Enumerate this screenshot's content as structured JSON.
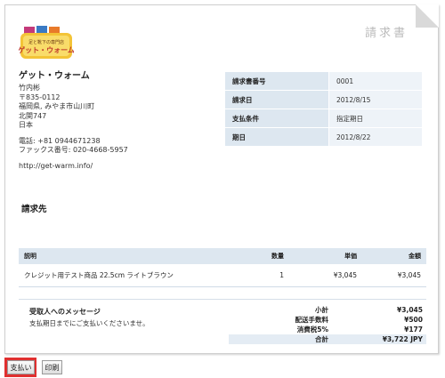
{
  "document": {
    "title": "請求書"
  },
  "logo": {
    "line1": "足と靴下の専門店",
    "line2": "ゲット・ウォーム"
  },
  "seller": {
    "name": "ゲット・ウォーム",
    "contact": "竹内彬",
    "postal": "〒835-0112",
    "address1": "福岡県, みやま市山川町",
    "address2": "北関747",
    "country": "日本",
    "phone": "電話: +81 0944671238",
    "fax": "ファックス番号: 020-4668-5957",
    "url": "http://get-warm.info/"
  },
  "meta": [
    {
      "label": "請求書番号",
      "value": "0001"
    },
    {
      "label": "請求日",
      "value": "2012/8/15"
    },
    {
      "label": "支払条件",
      "value": "指定期日"
    },
    {
      "label": "期日",
      "value": "2012/8/22"
    }
  ],
  "bill_to": {
    "title": "請求先"
  },
  "items": {
    "headers": {
      "desc": "説明",
      "qty": "数量",
      "unit": "単価",
      "amount": "金額"
    },
    "rows": [
      {
        "desc": "クレジット用テスト商品 22.5cm ライトブラウン",
        "qty": "1",
        "unit": "¥3,045",
        "amount": "¥3,045"
      }
    ]
  },
  "message": {
    "title": "受取人へのメッセージ",
    "body": "支払期日までにご支払いくださいませ。"
  },
  "totals": [
    {
      "label": "小計",
      "value": "¥3,045"
    },
    {
      "label": "配送手数料",
      "value": "¥500"
    },
    {
      "label": "消費税5%",
      "value": "¥177"
    },
    {
      "label": "合計",
      "value": "¥3,722 JPY"
    }
  ],
  "buttons": {
    "pay": "支払い",
    "print": "印刷"
  },
  "colors": {
    "table_header": "#dde7f0",
    "highlight": "#e03030",
    "logo_yellow": "#f3c437"
  }
}
